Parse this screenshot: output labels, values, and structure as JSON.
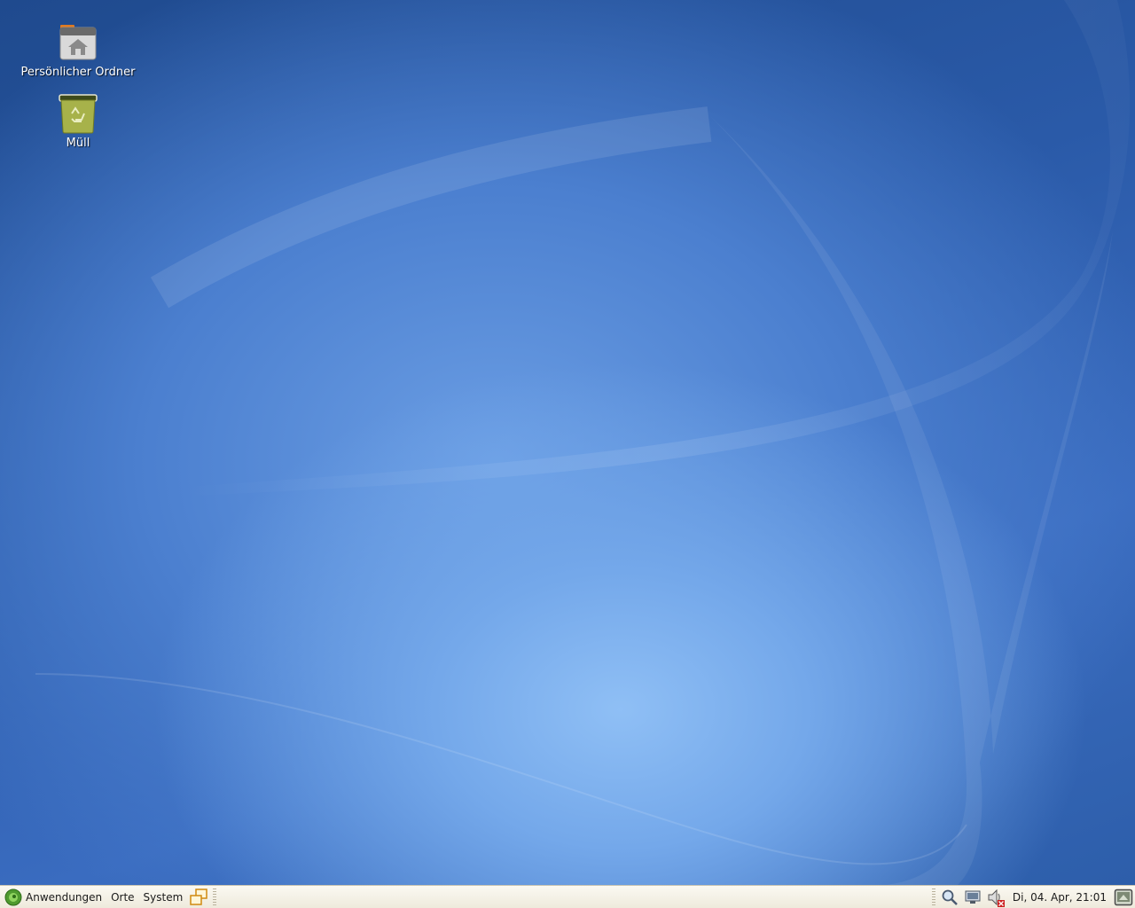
{
  "desktop": {
    "icons": [
      {
        "label": "Persönlicher Ordner",
        "icon": "home-folder-icon"
      },
      {
        "label": "Müll",
        "icon": "trash-icon"
      }
    ]
  },
  "panel": {
    "menus": {
      "applications": "Anwendungen",
      "places": "Orte",
      "system": "System"
    },
    "launchers": [
      "window-switcher-icon"
    ],
    "tray": [
      "search-icon",
      "network-icon",
      "volume-muted-icon"
    ],
    "clock": "Di, 04. Apr, 21:01",
    "show_desktop_icon": "show-desktop-icon"
  }
}
